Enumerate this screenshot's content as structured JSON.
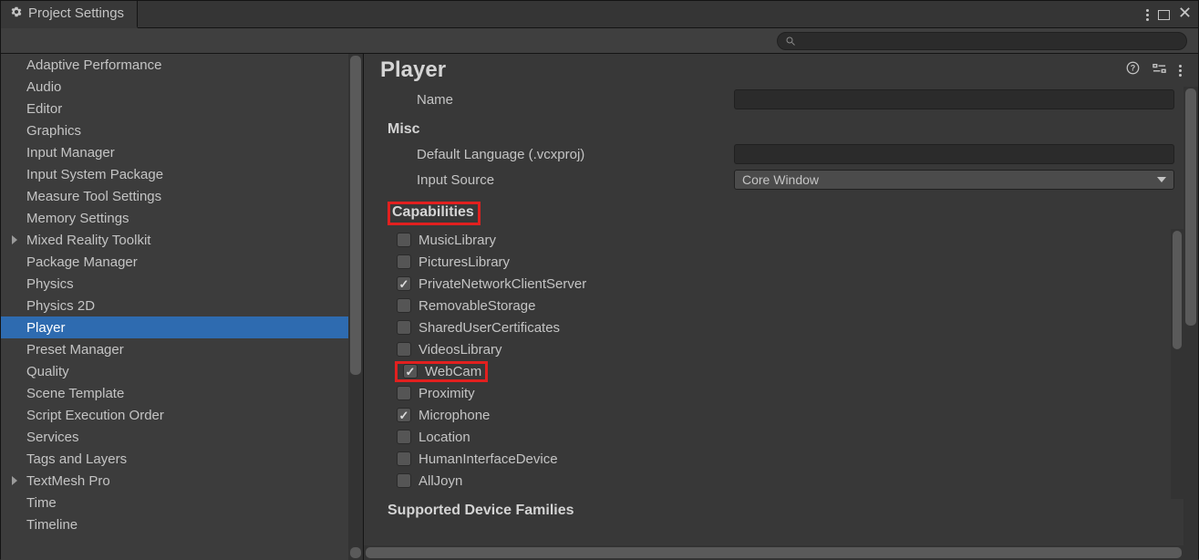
{
  "tab": {
    "title": "Project Settings"
  },
  "sidebar": {
    "items": [
      {
        "label": "Adaptive Performance",
        "arrow": false
      },
      {
        "label": "Audio",
        "arrow": false
      },
      {
        "label": "Editor",
        "arrow": false
      },
      {
        "label": "Graphics",
        "arrow": false
      },
      {
        "label": "Input Manager",
        "arrow": false
      },
      {
        "label": "Input System Package",
        "arrow": false
      },
      {
        "label": "Measure Tool Settings",
        "arrow": false
      },
      {
        "label": "Memory Settings",
        "arrow": false
      },
      {
        "label": "Mixed Reality Toolkit",
        "arrow": true
      },
      {
        "label": "Package Manager",
        "arrow": false
      },
      {
        "label": "Physics",
        "arrow": false
      },
      {
        "label": "Physics 2D",
        "arrow": false
      },
      {
        "label": "Player",
        "arrow": false,
        "selected": true
      },
      {
        "label": "Preset Manager",
        "arrow": false
      },
      {
        "label": "Quality",
        "arrow": false
      },
      {
        "label": "Scene Template",
        "arrow": false
      },
      {
        "label": "Script Execution Order",
        "arrow": false
      },
      {
        "label": "Services",
        "arrow": false
      },
      {
        "label": "Tags and Layers",
        "arrow": false
      },
      {
        "label": "TextMesh Pro",
        "arrow": true
      },
      {
        "label": "Time",
        "arrow": false
      },
      {
        "label": "Timeline",
        "arrow": false
      }
    ]
  },
  "content": {
    "title": "Player",
    "name_label": "Name",
    "misc_label": "Misc",
    "default_lang_label": "Default Language (.vcxproj)",
    "input_source_label": "Input Source",
    "input_source_value": "Core Window",
    "capabilities_label": "Capabilities",
    "capabilities": [
      {
        "label": "MusicLibrary",
        "checked": false
      },
      {
        "label": "PicturesLibrary",
        "checked": false
      },
      {
        "label": "PrivateNetworkClientServer",
        "checked": true
      },
      {
        "label": "RemovableStorage",
        "checked": false
      },
      {
        "label": "SharedUserCertificates",
        "checked": false
      },
      {
        "label": "VideosLibrary",
        "checked": false
      },
      {
        "label": "WebCam",
        "checked": true,
        "highlight": true
      },
      {
        "label": "Proximity",
        "checked": false
      },
      {
        "label": "Microphone",
        "checked": true
      },
      {
        "label": "Location",
        "checked": false
      },
      {
        "label": "HumanInterfaceDevice",
        "checked": false
      },
      {
        "label": "AllJoyn",
        "checked": false
      }
    ],
    "supported_families_label": "Supported Device Families"
  }
}
